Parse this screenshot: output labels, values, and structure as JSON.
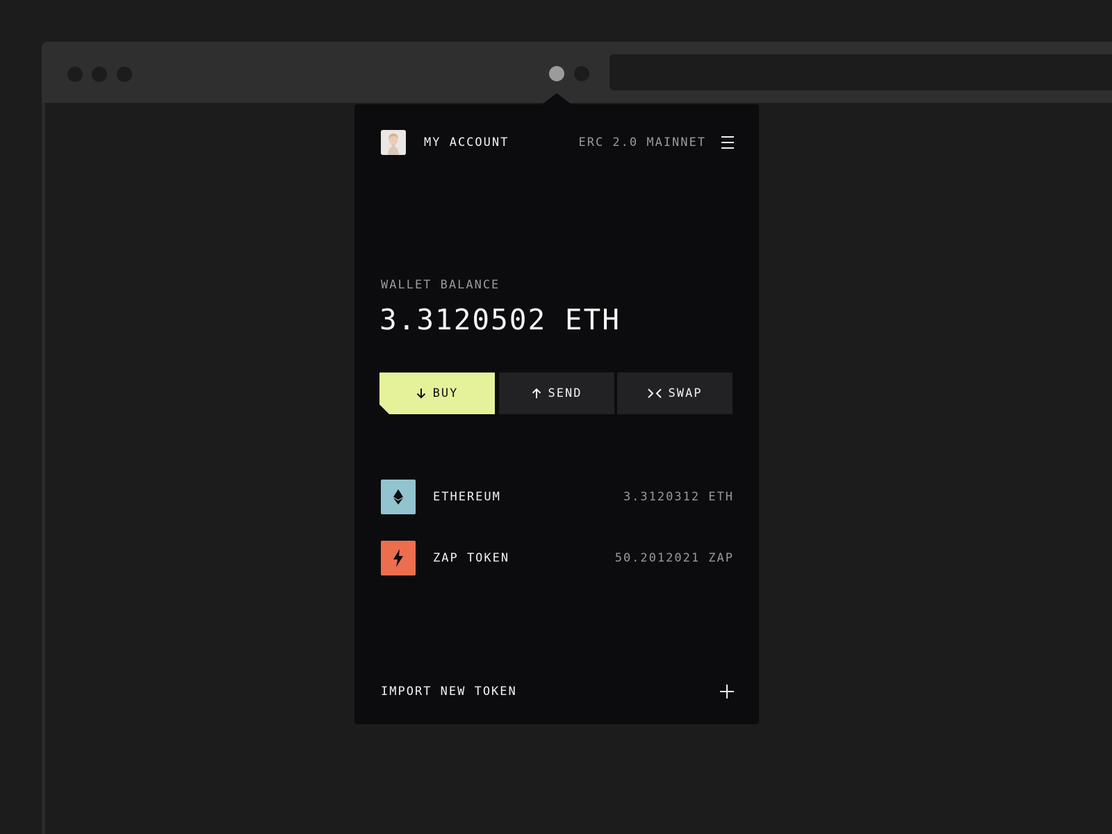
{
  "header": {
    "account_label": "MY ACCOUNT",
    "network_label": "ERC 2.0 MAINNET",
    "menu_icon": "hamburger-menu-icon",
    "avatar_icon": "user-avatar"
  },
  "balance": {
    "label": "WALLET BALANCE",
    "value": "3.3120502 ETH"
  },
  "actions": {
    "buy_label": "BUY",
    "buy_icon": "arrow-down-icon",
    "send_label": "SEND",
    "send_icon": "arrow-up-icon",
    "swap_label": "SWAP",
    "swap_icon": "swap-icon"
  },
  "tokens": [
    {
      "name": "ETHEREUM",
      "amount": "3.3120312 ETH",
      "icon": "ethereum-icon",
      "color": "#92c4cf"
    },
    {
      "name": "ZAP TOKEN",
      "amount": "50.2012021 ZAP",
      "icon": "lightning-icon",
      "color": "#ec6e4e"
    }
  ],
  "import": {
    "label": "IMPORT NEW TOKEN",
    "icon": "plus-icon"
  },
  "colors": {
    "accent": "#e5f29a",
    "popup_bg": "#0c0c0e",
    "page_bg": "#1c1c1c",
    "active_extension_dot": "#9b9b9b"
  }
}
